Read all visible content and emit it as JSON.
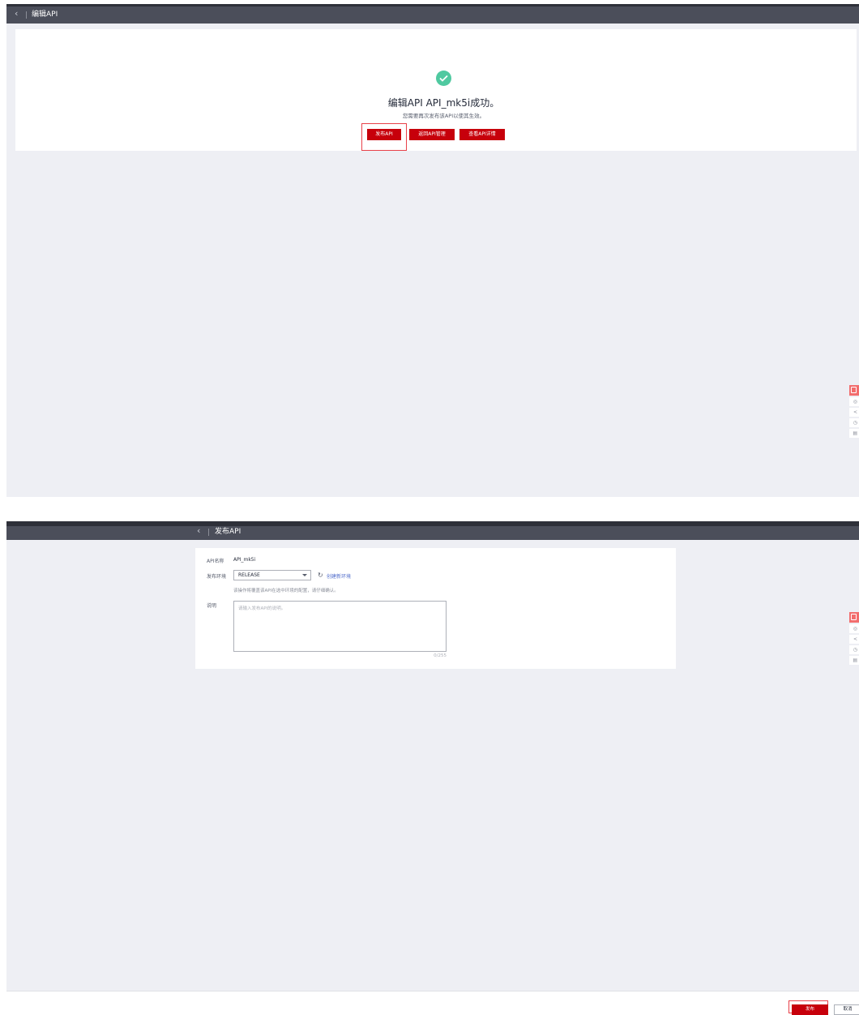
{
  "screen1": {
    "header": {
      "back_icon": "chevron-left-icon",
      "title": "编辑API"
    },
    "result": {
      "icon": "check-circle-icon",
      "title": "编辑API API_mk5i成功。",
      "subtitle": "您需要再次发布该API以使其生效。"
    },
    "buttons": {
      "publish": "发布API",
      "back_to_manage": "返回API管理",
      "view_detail": "查看API详情"
    },
    "side_tools": [
      "edit-icon",
      "feedback-icon",
      "share-icon",
      "help-icon",
      "doc-icon"
    ]
  },
  "screen2": {
    "header": {
      "back_icon": "chevron-left-icon",
      "title": "发布API"
    },
    "form": {
      "api_name_label": "API名称",
      "api_name_value": "API_mk5i",
      "env_label": "发布环境",
      "env_value": "RELEASE",
      "create_env_link": "创建新环境",
      "hint": "该操作将覆盖该API在选中环境的配置，请仔细确认。",
      "desc_label": "说明",
      "desc_placeholder": "请输入发布API的说明。",
      "counter": "0/255"
    },
    "side_tools": [
      "edit-icon",
      "feedback-icon",
      "share-icon",
      "help-icon",
      "doc-icon"
    ]
  },
  "footer": {
    "publish": "发布",
    "cancel": "取消"
  },
  "colors": {
    "brand_red": "#c7000b",
    "topbar": "#4b4e5a",
    "success": "#4fc9a0",
    "link": "#526ecc"
  }
}
